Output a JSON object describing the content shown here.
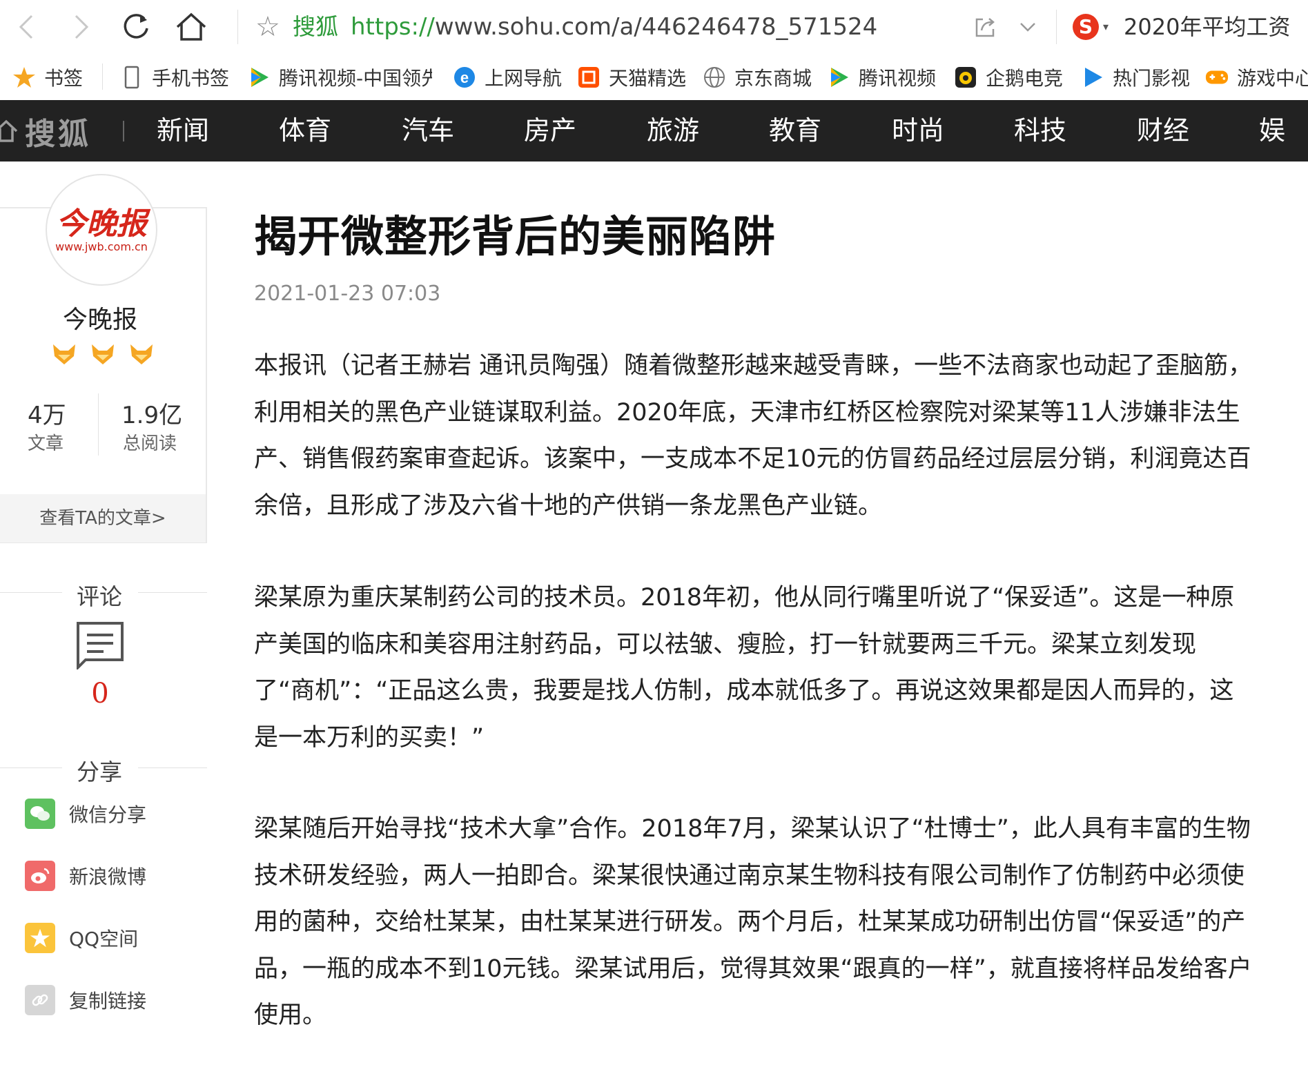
{
  "browser": {
    "site_name": "搜狐",
    "url_protocol": "https://",
    "url_rest": "www.sohu.com/a/446246478_571524",
    "search_logo": "S",
    "search_text": "2020年平均工资"
  },
  "bookmarks": [
    {
      "label": "书签",
      "icon": "star-icon"
    },
    {
      "label": "手机书签",
      "icon": "phone-icon"
    },
    {
      "label": "腾讯视频-中国领先",
      "icon": "play-icon"
    },
    {
      "label": "上网导航",
      "icon": "ie-icon"
    },
    {
      "label": "天猫精选",
      "icon": "tmall-icon"
    },
    {
      "label": "京东商城",
      "icon": "globe-icon"
    },
    {
      "label": "腾讯视频",
      "icon": "play-icon"
    },
    {
      "label": "企鹅电竞",
      "icon": "penguin-icon"
    },
    {
      "label": "热门影视",
      "icon": "video-icon"
    },
    {
      "label": "游戏中心",
      "icon": "gamepad-icon"
    }
  ],
  "topnav": {
    "logo": "搜狐",
    "links": [
      "新闻",
      "体育",
      "汽车",
      "房产",
      "旅游",
      "教育",
      "时尚",
      "科技",
      "财经",
      "娱乐"
    ]
  },
  "profile": {
    "avatar_brand": "今晚报",
    "avatar_domain": "www.jwb.com.cn",
    "name": "今晚报",
    "articles_count": "4万",
    "articles_label": "文章",
    "reads_count": "1.9亿",
    "reads_label": "总阅读",
    "view_link": "查看TA的文章>"
  },
  "comments": {
    "title": "评论",
    "count": "0"
  },
  "share": {
    "title": "分享",
    "items": [
      {
        "label": "微信分享",
        "color": "#5ec160"
      },
      {
        "label": "新浪微博",
        "color": "#f06a6a"
      },
      {
        "label": "QQ空间",
        "color": "#fbc43b"
      },
      {
        "label": "复制链接",
        "color": "#d6d6d6"
      }
    ]
  },
  "article": {
    "title": "揭开微整形背后的美丽陷阱",
    "date": "2021-01-23 07:03",
    "paragraphs": [
      "本报讯（记者王赫岩 通讯员陶强）随着微整形越来越受青睐，一些不法商家也动起了歪脑筋，利用相关的黑色产业链谋取利益。2020年底，天津市红桥区检察院对梁某等11人涉嫌非法生产、销售假药案审查起诉。该案中，一支成本不足10元的仿冒药品经过层层分销，利润竟达百余倍，且形成了涉及六省十地的产供销一条龙黑色产业链。",
      "梁某原为重庆某制药公司的技术员。2018年初，他从同行嘴里听说了“保妥适”。这是一种原产美国的临床和美容用注射药品，可以祛皱、瘦脸，打一针就要两三千元。梁某立刻发现了“商机”：“正品这么贵，我要是找人仿制，成本就低多了。再说这效果都是因人而异的，这是一本万利的买卖！”",
      "梁某随后开始寻找“技术大拿”合作。2018年7月，梁某认识了“杜博士”，此人具有丰富的生物技术研发经验，两人一拍即合。梁某很快通过南京某生物科技有限公司制作了仿制药中必须使用的菌种，交给杜某某，由杜某某进行研发。两个月后，杜某某成功研制出仿冒“保妥适”的产品，一瓶的成本不到10元钱。梁某试用后，觉得其效果“跟真的一样”，就直接将样品发给客户使用。"
    ]
  }
}
